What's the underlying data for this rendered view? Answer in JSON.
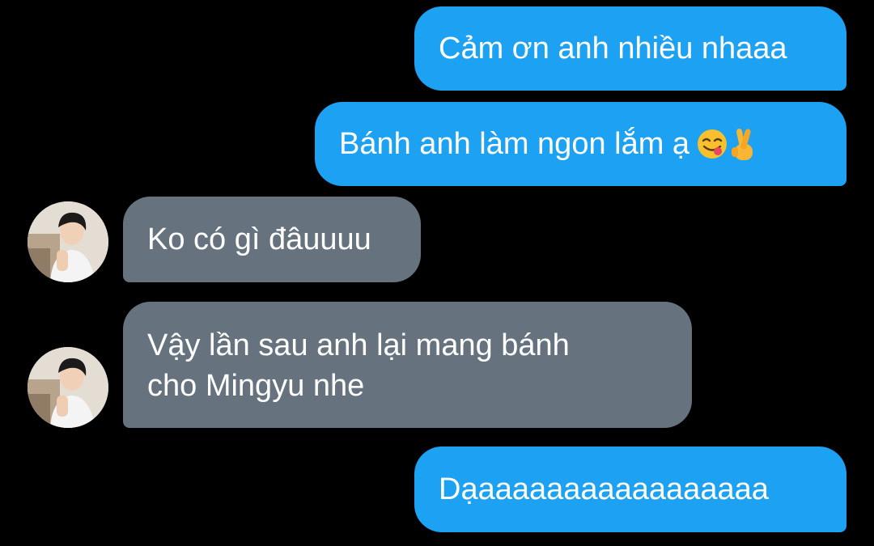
{
  "messages": [
    {
      "side": "sent",
      "text": "Cảm ơn anh nhiều nhaaa"
    },
    {
      "side": "sent",
      "text": "Bánh anh làm ngon lắm ạ",
      "emojis": [
        "yummy-face-emoji",
        "crossed-fingers-emoji"
      ]
    },
    {
      "side": "received",
      "text": "Ko có gì đâuuuu",
      "avatar": "profile-photo"
    },
    {
      "side": "received",
      "lines": [
        "Vậy lần sau anh lại mang bánh",
        "cho Mingyu nhe"
      ],
      "avatar": "profile-photo"
    },
    {
      "side": "sent",
      "text": "Dạaaaaaaaaaaaaaaaaa"
    }
  ],
  "colors": {
    "background": "#000000",
    "sent_bubble": "#1da1f2",
    "received_bubble": "#66737f",
    "text": "#ffffff"
  }
}
